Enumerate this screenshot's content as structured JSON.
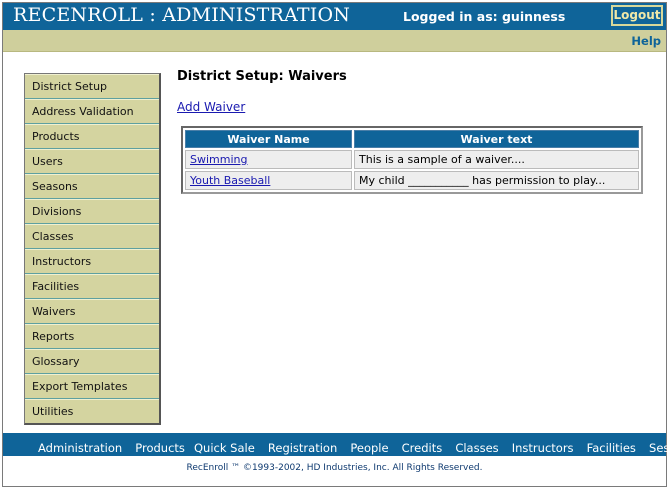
{
  "header": {
    "app_title": "RECENROLL : ADMINISTRATION",
    "login_text": "Logged in as: guinness",
    "logout_label": "Logout",
    "help_label": "Help"
  },
  "sidebar": {
    "items": [
      {
        "label": "District Setup"
      },
      {
        "label": "Address Validation"
      },
      {
        "label": "Products"
      },
      {
        "label": "Users"
      },
      {
        "label": "Seasons"
      },
      {
        "label": "Divisions"
      },
      {
        "label": "Classes"
      },
      {
        "label": "Instructors"
      },
      {
        "label": "Facilities"
      },
      {
        "label": "Waivers"
      },
      {
        "label": "Reports"
      },
      {
        "label": "Glossary"
      },
      {
        "label": "Export Templates"
      },
      {
        "label": "Utilities"
      }
    ]
  },
  "main": {
    "title": "District Setup: Waivers",
    "add_link": "Add Waiver",
    "table": {
      "headers": [
        "Waiver Name",
        "Waiver text"
      ],
      "rows": [
        {
          "name": "Swimming ",
          "text": "This is a sample of a waiver...."
        },
        {
          "name": "Youth Baseball",
          "text": "My child ___________ has permission to play..."
        }
      ]
    }
  },
  "bottom_nav": {
    "items": [
      "Administration",
      "Products",
      "Quick Sale",
      "Registration",
      "People",
      "Credits",
      "Classes",
      "Instructors",
      "Facilities",
      "Sessions"
    ]
  },
  "footer": {
    "text": "RecEnroll ™ ©1993-2002,  HD Industries, Inc.  All Rights Reserved."
  },
  "colors": {
    "brand_blue": "#0f6499",
    "khaki": "#cfcf9c"
  }
}
